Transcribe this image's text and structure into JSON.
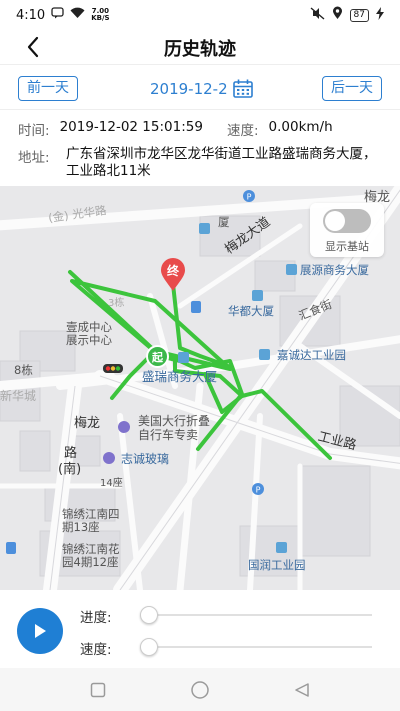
{
  "status_bar": {
    "time": "4:10",
    "net_speed_value": "7.00",
    "net_speed_unit": "KB/S",
    "battery": "87"
  },
  "header": {
    "title": "历史轨迹",
    "back_icon": "chevron-left-icon"
  },
  "day_nav": {
    "prev_label": "前一天",
    "date": "2019-12-2",
    "next_label": "后一天",
    "calendar_icon": "calendar-icon"
  },
  "info": {
    "time_label": "时间:",
    "time_value": "2019-12-02 15:01:59",
    "speed_label": "速度:",
    "speed_value": "0.00km/h",
    "address_label": "地址:",
    "address_value": "广东省深圳市龙华区龙华街道工业路盛瑞商务大厦，工业路北11米"
  },
  "map": {
    "start_marker": "起",
    "end_marker": "终",
    "base_station_label": "显示基站",
    "base_station_on": false,
    "track_color": "#3cc43c",
    "labels": {
      "meilong": "梅龙",
      "meilong_road_v": "梅龙大道",
      "zhanyuan": "展源商务大厦",
      "huadu": "华都大厦",
      "huishi": "汇食街",
      "yicheng1": "壹成中心",
      "yicheng2": "展示中心",
      "jiachengda": "嘉诚达工业园",
      "shengrui": "盛瑞商务大厦",
      "bldg8": "8栋",
      "xinhuacheng": "新华城",
      "meilong_road1": "梅龙",
      "meilong_road2": "路",
      "meilong_road3": "(南)",
      "meiguo1": "美国大行折叠",
      "meiguo2": "自行车专卖",
      "gongye_road": "工业路",
      "zhicheng": "志诚玻璃",
      "bldg14": "14座",
      "jinxiu1": "锦绣江南四",
      "jinxiu2": "期13座",
      "jinxiu3": "锦绣江南花",
      "jinxiu4": "园4期12座",
      "guorun": "国润工业园",
      "bldg3": "3栋",
      "road_top": "(金)",
      "road_top2": "光华路",
      "road_top3": "厦"
    }
  },
  "playback": {
    "progress_label": "进度:",
    "speed_label": "速度:",
    "progress": 0,
    "speed": 0
  }
}
